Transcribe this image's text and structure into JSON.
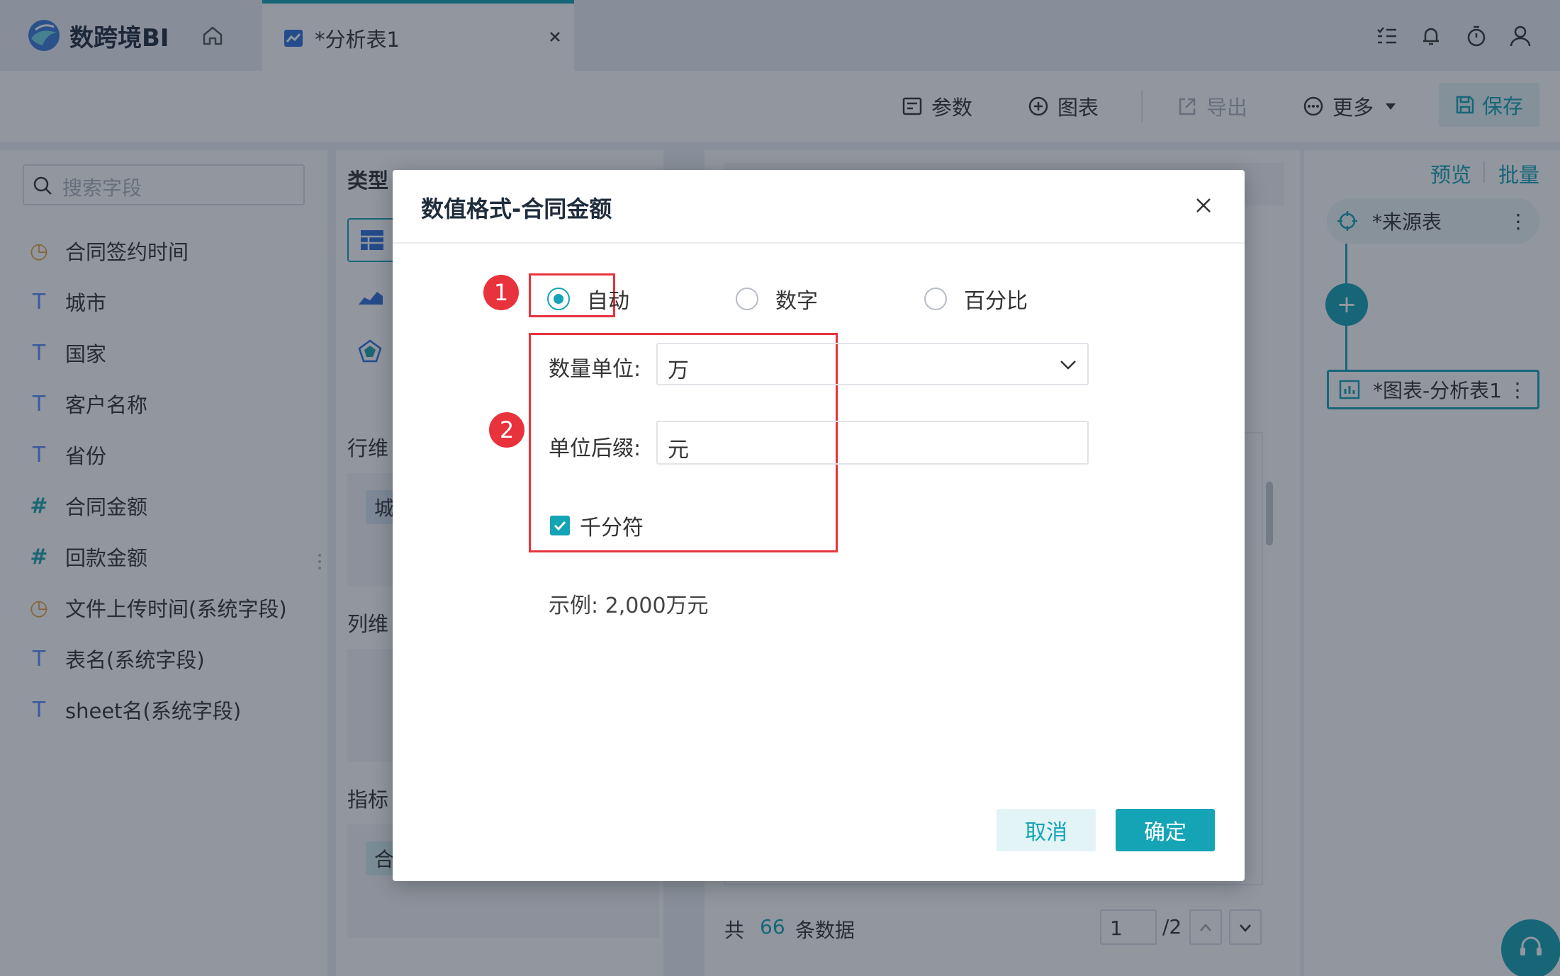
{
  "app": {
    "name": "数跨境BI",
    "tab_title": "*分析表1"
  },
  "toolbar": {
    "params_label": "参数",
    "chart_label": "图表",
    "export_label": "导出",
    "more_label": "更多",
    "save_label": "保存"
  },
  "left_panel": {
    "search_placeholder": "搜索字段",
    "fields": [
      {
        "icon": "clock-icon",
        "label": "合同签约时间"
      },
      {
        "icon": "text-field-icon",
        "label": "城市"
      },
      {
        "icon": "text-field-icon",
        "label": "国家"
      },
      {
        "icon": "text-field-icon",
        "label": "客户名称"
      },
      {
        "icon": "text-field-icon",
        "label": "省份"
      },
      {
        "icon": "number-field-icon",
        "label": "合同金额"
      },
      {
        "icon": "number-field-icon",
        "label": "回款金额"
      },
      {
        "icon": "clock-icon",
        "label": "文件上传时间(系统字段)"
      },
      {
        "icon": "text-field-icon",
        "label": "表名(系统字段)"
      },
      {
        "icon": "text-field-icon",
        "label": "sheet名(系统字段)"
      }
    ]
  },
  "middle_panel": {
    "type_label": "类型",
    "row_dim_label": "行维度",
    "row_dim_visible": "行维",
    "row_pill": "城",
    "col_dim_visible": "列维",
    "metric_label": "指标",
    "metric_pill": "合"
  },
  "flow_panel": {
    "preview_label": "预览",
    "batch_label": "批量",
    "source_node": "*来源表",
    "chart_node": "*图表-分析表1"
  },
  "pager": {
    "total_prefix": "共",
    "total_count": "66",
    "total_suffix": "条数据",
    "page_input": "1",
    "page_total": "/2"
  },
  "dialog": {
    "title": "数值格式-合同金额",
    "format_options": [
      {
        "label": "自动",
        "selected": true
      },
      {
        "label": "数字",
        "selected": false
      },
      {
        "label": "百分比",
        "selected": false
      }
    ],
    "unit_label": "数量单位:",
    "unit_value": "万",
    "suffix_label": "单位后缀:",
    "suffix_value": "元",
    "thousands_label": "千分符",
    "thousands_checked": true,
    "example_text": "示例: 2,000万元",
    "cancel_label": "取消",
    "ok_label": "确定",
    "annotation_1": "1",
    "annotation_2": "2"
  },
  "colors": {
    "accent": "#14a4b5",
    "annotation_red": "#e8323c"
  }
}
